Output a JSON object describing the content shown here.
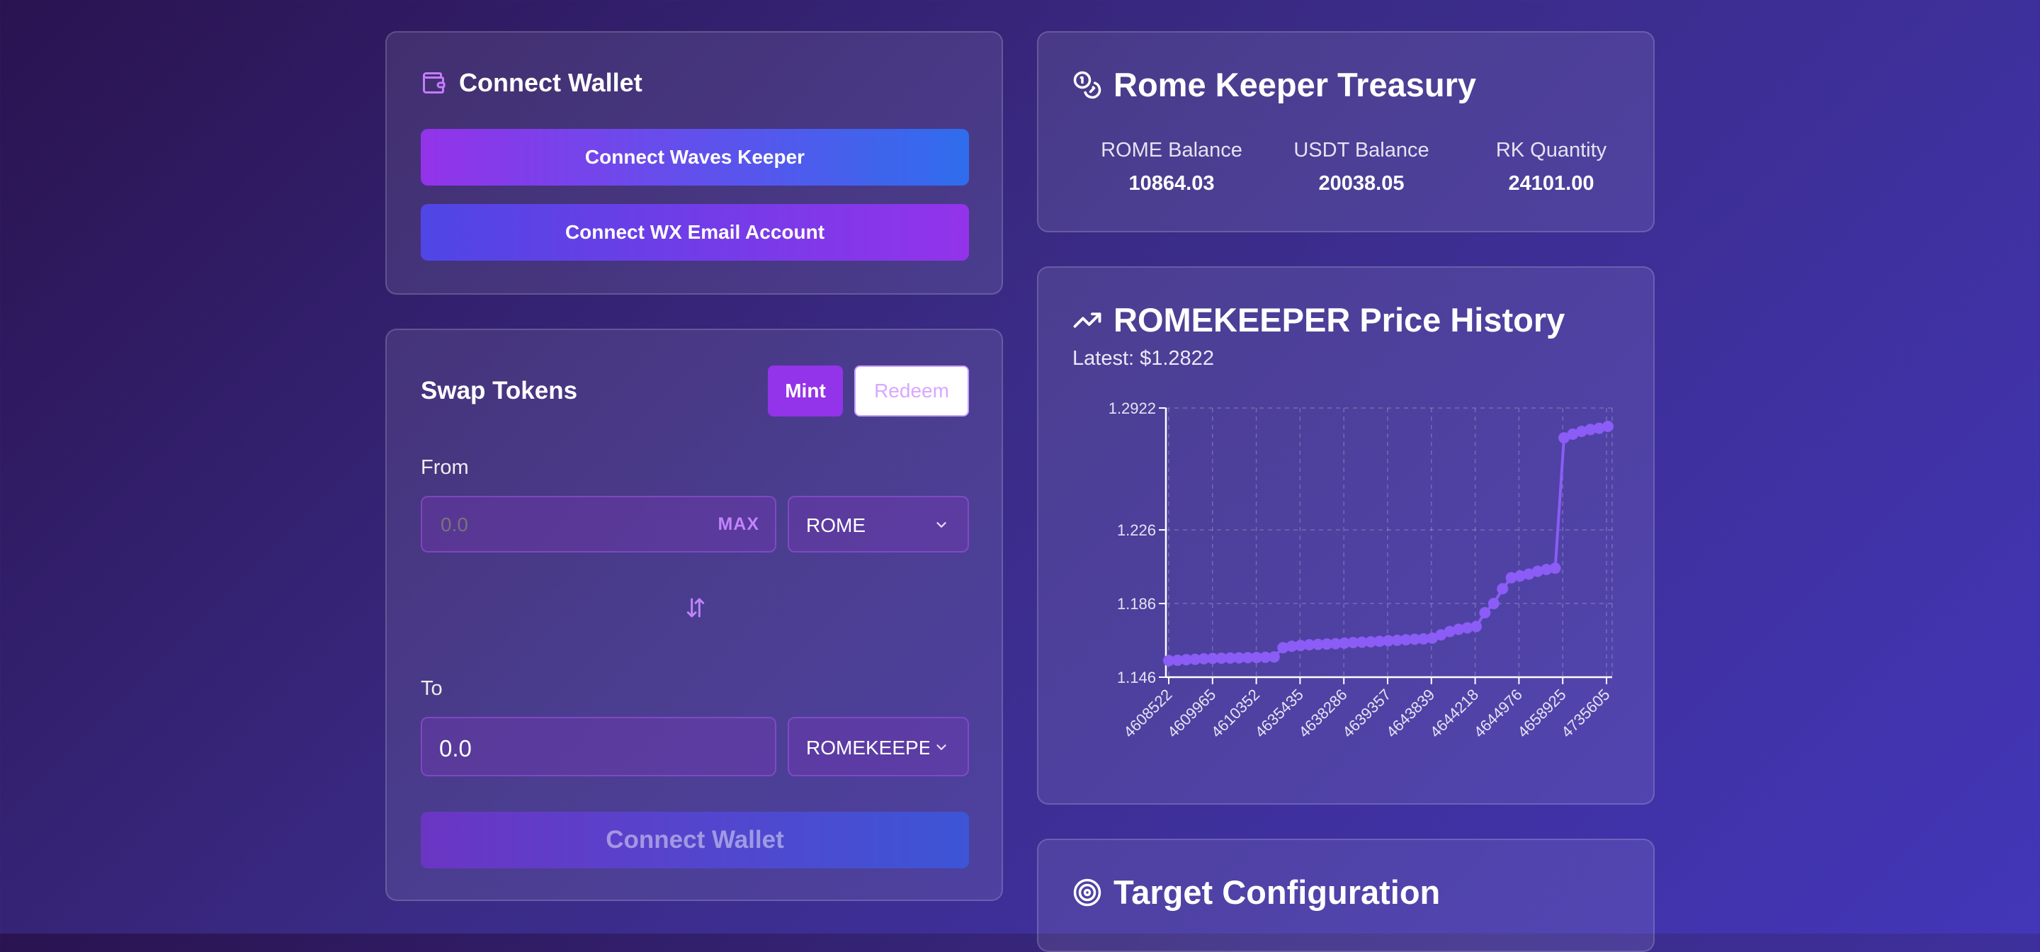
{
  "wallet": {
    "title": "Connect Wallet",
    "waves_keeper_label": "Connect Waves Keeper",
    "wx_email_label": "Connect WX Email Account"
  },
  "swap": {
    "title": "Swap Tokens",
    "mint_label": "Mint",
    "redeem_label": "Redeem",
    "from_label": "From",
    "from_placeholder": "0.0",
    "max_label": "MAX",
    "from_token": "ROME",
    "to_label": "To",
    "to_value": "0.0",
    "to_token": "ROMEKEEPER",
    "submit_label": "Connect Wallet"
  },
  "treasury": {
    "title": "Rome Keeper Treasury",
    "stats": [
      {
        "label": "ROME Balance",
        "value": "10864.03"
      },
      {
        "label": "USDT Balance",
        "value": "20038.05"
      },
      {
        "label": "RK Quantity",
        "value": "24101.00"
      }
    ]
  },
  "price_history": {
    "title": "ROMEKEEPER Price History",
    "latest": "Latest: $1.2822"
  },
  "target": {
    "title": "Target Configuration"
  },
  "colors": {
    "accent": "#8b3de6",
    "line": "#8b5cf6",
    "gradient_blue": "#2f6ded"
  },
  "chart_data": {
    "type": "line",
    "title": "",
    "xlabel": "",
    "ylabel": "",
    "ylim": [
      1.146,
      1.2922
    ],
    "y_ticks": [
      "1.2922",
      "1.226",
      "1.186",
      "1.146"
    ],
    "x_ticks": [
      "4608522",
      "4609965",
      "4610352",
      "4635435",
      "4638286",
      "4639357",
      "4643839",
      "4644218",
      "4644976",
      "4658925",
      "4735605"
    ],
    "grid": true,
    "series": [
      {
        "values": [
          1.155,
          1.1552,
          1.1555,
          1.1557,
          1.156,
          1.1562,
          1.1563,
          1.1564,
          1.1565,
          1.1566,
          1.1567,
          1.1568,
          1.157,
          1.162,
          1.1628,
          1.1632,
          1.1636,
          1.1638,
          1.164,
          1.1642,
          1.1645,
          1.1648,
          1.165,
          1.1652,
          1.1655,
          1.1658,
          1.166,
          1.1663,
          1.1666,
          1.1668,
          1.1672,
          1.169,
          1.1708,
          1.172,
          1.1728,
          1.1735,
          1.181,
          1.186,
          1.194,
          1.2,
          1.201,
          1.202,
          1.2035,
          1.2045,
          1.2052,
          1.276,
          1.278,
          1.2795,
          1.2805,
          1.2812,
          1.2822
        ]
      }
    ]
  }
}
